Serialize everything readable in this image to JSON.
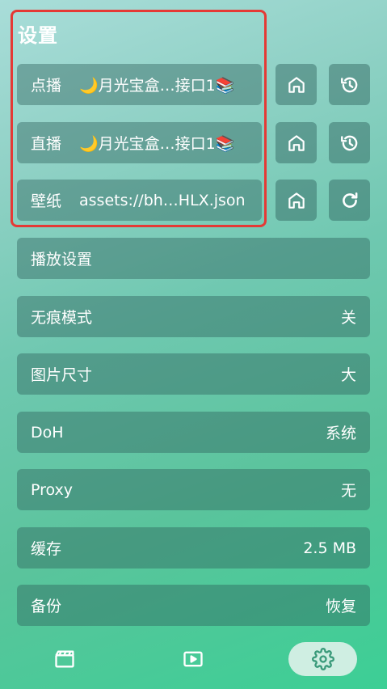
{
  "page_title": "设置",
  "sources": [
    {
      "label": "点播",
      "value": "🌙月光宝盒…接口1📚",
      "icons": [
        "home-icon",
        "history-icon"
      ]
    },
    {
      "label": "直播",
      "value": "🌙月光宝盒…接口1📚",
      "icons": [
        "home-icon",
        "history-icon"
      ]
    },
    {
      "label": "壁纸",
      "value": "assets://bh…HLX.json",
      "icons": [
        "home-icon",
        "refresh-icon"
      ]
    }
  ],
  "settings": [
    {
      "label": "播放设置",
      "value": ""
    },
    {
      "label": "无痕模式",
      "value": "关"
    },
    {
      "label": "图片尺寸",
      "value": "大"
    },
    {
      "label": "DoH",
      "value": "系统"
    },
    {
      "label": "Proxy",
      "value": "无"
    },
    {
      "label": "缓存",
      "value": "2.5 MB"
    },
    {
      "label": "备份",
      "value": "恢复"
    }
  ],
  "nav": {
    "items": [
      "film-icon",
      "play-icon",
      "gear-icon"
    ],
    "active": "gear-icon"
  },
  "colors": {
    "highlight_border": "#e53935",
    "active_nav_bg": "#cfeee2",
    "active_nav_icon": "#3a9a7a"
  }
}
